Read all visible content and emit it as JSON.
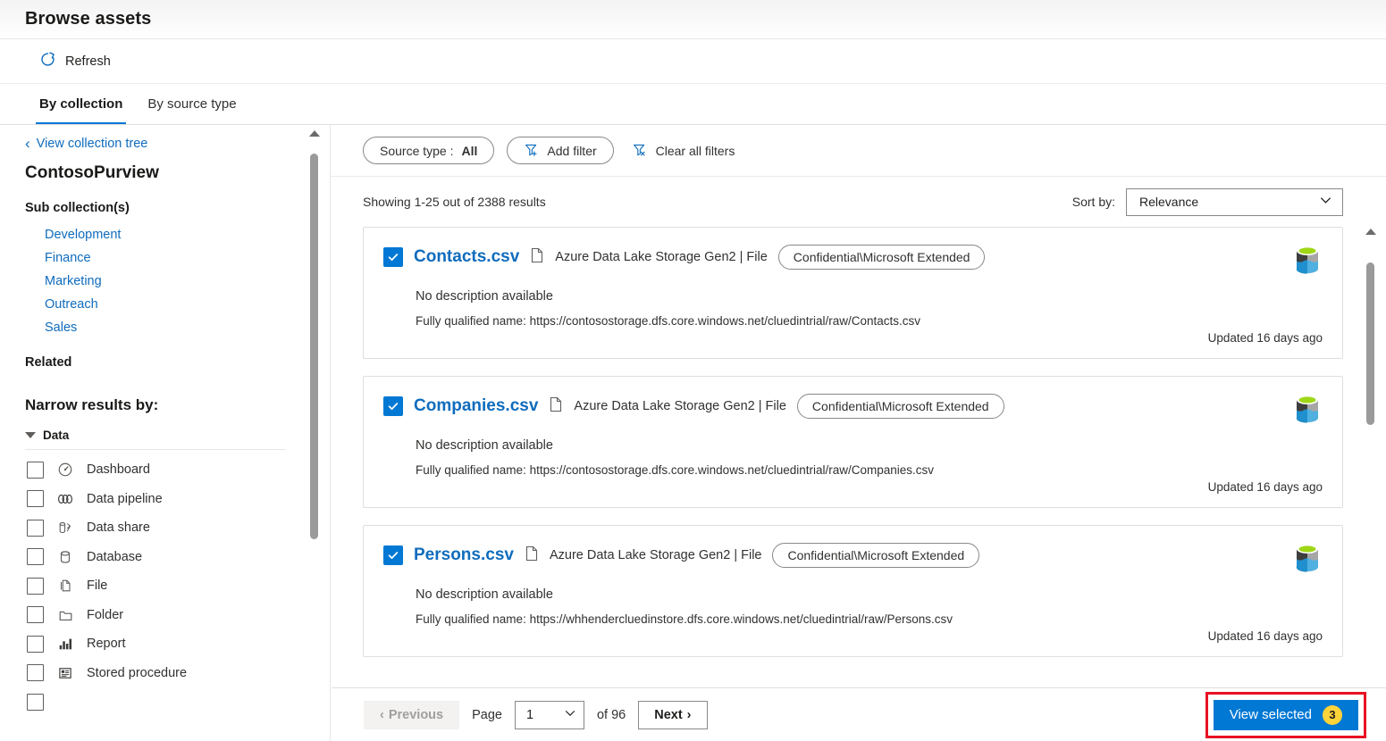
{
  "header": {
    "title": "Browse assets"
  },
  "command_bar": {
    "refresh_label": "Refresh",
    "refresh_icon": "refresh-icon"
  },
  "tabs": [
    {
      "label": "By collection",
      "active": true
    },
    {
      "label": "By source type",
      "active": false
    }
  ],
  "sidebar": {
    "back_link": "View collection tree",
    "collection_name": "ContosoPurview",
    "sub_collections_heading": "Sub collection(s)",
    "sub_collections": [
      "Development",
      "Finance",
      "Marketing",
      "Outreach",
      "Sales"
    ],
    "related_heading": "Related",
    "narrow_heading": "Narrow results by:",
    "facet_group": {
      "label": "Data",
      "expanded": true
    },
    "facets": [
      {
        "label": "Dashboard",
        "icon": "dashboard-icon",
        "checked": false
      },
      {
        "label": "Data pipeline",
        "icon": "data-pipeline-icon",
        "checked": false
      },
      {
        "label": "Data share",
        "icon": "data-share-icon",
        "checked": false
      },
      {
        "label": "Database",
        "icon": "database-icon",
        "checked": false
      },
      {
        "label": "File",
        "icon": "file-icon",
        "checked": false
      },
      {
        "label": "Folder",
        "icon": "folder-icon",
        "checked": false
      },
      {
        "label": "Report",
        "icon": "report-icon",
        "checked": false
      },
      {
        "label": "Stored procedure",
        "icon": "stored-procedure-icon",
        "checked": false
      }
    ]
  },
  "filters": {
    "source_type_pill": "Source type : ",
    "source_type_value": "All",
    "add_filter": "Add filter",
    "clear_all_filters": "Clear all filters"
  },
  "results_meta": {
    "showing": "Showing 1-25 out of 2388 results",
    "sort_label": "Sort by:",
    "sort_value": "Relevance"
  },
  "results": [
    {
      "name": "Contacts.csv",
      "type": "Azure Data Lake Storage Gen2 | File",
      "sensitivity_label": "Confidential\\Microsoft Extended",
      "description": "No description available",
      "fqn": "Fully qualified name: https://contosostorage.dfs.core.windows.net/cluedintrial/raw/Contacts.csv",
      "updated": "Updated 16 days ago",
      "selected": true,
      "asset_icon": "azure-data-lake-storage-icon"
    },
    {
      "name": "Companies.csv",
      "type": "Azure Data Lake Storage Gen2 | File",
      "sensitivity_label": "Confidential\\Microsoft Extended",
      "description": "No description available",
      "fqn": "Fully qualified name: https://contosostorage.dfs.core.windows.net/cluedintrial/raw/Companies.csv",
      "updated": "Updated 16 days ago",
      "selected": true,
      "asset_icon": "azure-data-lake-storage-icon"
    },
    {
      "name": "Persons.csv",
      "type": "Azure Data Lake Storage Gen2 | File",
      "sensitivity_label": "Confidential\\Microsoft Extended",
      "description": "No description available",
      "fqn": "Fully qualified name: https://whhendercluedinstore.dfs.core.windows.net/cluedintrial/raw/Persons.csv",
      "updated": "Updated 16 days ago",
      "selected": true,
      "asset_icon": "azure-data-lake-storage-icon"
    }
  ],
  "footer": {
    "previous": "Previous",
    "page_word": "Page",
    "page_value": "1",
    "of_total": "of 96",
    "next": "Next",
    "view_selected": "View selected",
    "selected_count": "3"
  },
  "colors": {
    "accent": "#0078d4",
    "link": "#0f6cbd",
    "highlight_outline": "#e81123",
    "badge": "#ffd43b"
  }
}
